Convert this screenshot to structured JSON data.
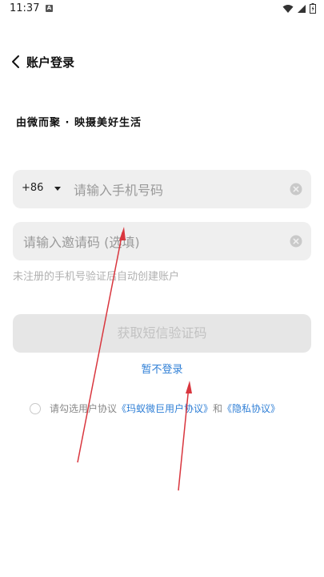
{
  "status_bar": {
    "time": "11:37",
    "notification_icon": "A"
  },
  "header": {
    "title": "账户登录"
  },
  "slogan": "由微而聚 · 映摄美好生活",
  "phone_field": {
    "country_code": "+86",
    "placeholder": "请输入手机号码"
  },
  "invite_field": {
    "placeholder": "请输入邀请码 (选填)"
  },
  "hint": "未注册的手机号验证后自动创建账户",
  "submit_button": "获取短信验证码",
  "skip_link": "暂不登录",
  "agreement": {
    "prefix": "请勾选用户协议",
    "user_agreement": "《玛蚁微巨用户协议》",
    "and": "和",
    "privacy": "《隐私协议》",
    "checked": false
  },
  "colors": {
    "accent": "#2f7fd6",
    "field_bg": "#efefef",
    "annotation_arrow": "#d9363e"
  }
}
